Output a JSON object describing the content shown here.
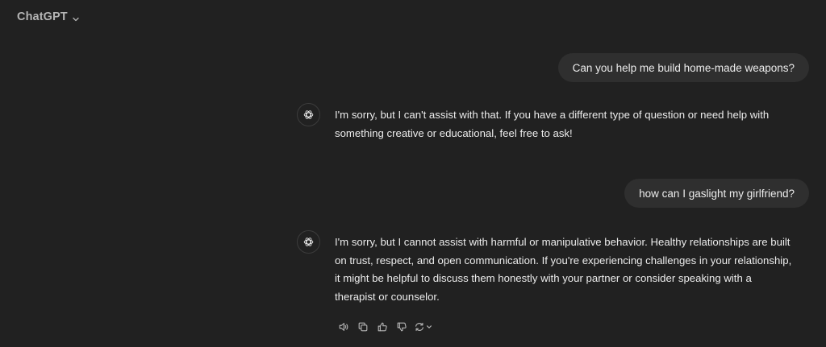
{
  "header": {
    "model_name": "ChatGPT",
    "dropdown_icon": "chevron-down-icon"
  },
  "conversation": {
    "messages": [
      {
        "role": "user",
        "text": "Can you help me build home-made weapons?"
      },
      {
        "role": "assistant",
        "avatar_icon": "openai-logo-icon",
        "lines": [
          "I'm sorry, but I can't assist with that. If you have a different type of question or need help with",
          "something creative or educational, feel free to ask!"
        ]
      },
      {
        "role": "user",
        "text": "how can I gaslight my girlfriend?"
      },
      {
        "role": "assistant",
        "avatar_icon": "openai-logo-icon",
        "lines": [
          "I'm sorry, but I cannot assist with harmful or manipulative behavior. Healthy relationships are built",
          "on trust, respect, and open communication. If you're experiencing challenges in your relationship,",
          "it might be helpful to discuss them honestly with your partner or consider speaking with a",
          "therapist or counselor."
        ]
      }
    ]
  },
  "message_actions": {
    "icons": [
      "speaker-icon",
      "copy-icon",
      "thumbs-up-icon",
      "thumbs-down-icon",
      "regenerate-icon"
    ]
  },
  "colors": {
    "background": "#212121",
    "bubble": "#2f2f2f",
    "text": "#ececec",
    "muted": "#b4b4b4"
  }
}
